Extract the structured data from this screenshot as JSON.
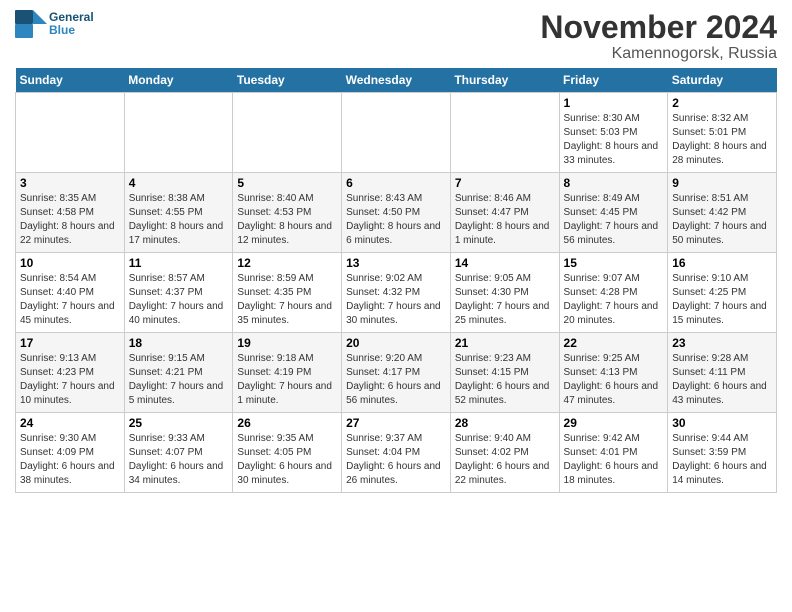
{
  "header": {
    "logo_line1": "General",
    "logo_line2": "Blue",
    "month_year": "November 2024",
    "location": "Kamennogorsk, Russia"
  },
  "weekdays": [
    "Sunday",
    "Monday",
    "Tuesday",
    "Wednesday",
    "Thursday",
    "Friday",
    "Saturday"
  ],
  "weeks": [
    [
      {
        "day": "",
        "info": ""
      },
      {
        "day": "",
        "info": ""
      },
      {
        "day": "",
        "info": ""
      },
      {
        "day": "",
        "info": ""
      },
      {
        "day": "",
        "info": ""
      },
      {
        "day": "1",
        "info": "Sunrise: 8:30 AM\nSunset: 5:03 PM\nDaylight: 8 hours and 33 minutes."
      },
      {
        "day": "2",
        "info": "Sunrise: 8:32 AM\nSunset: 5:01 PM\nDaylight: 8 hours and 28 minutes."
      }
    ],
    [
      {
        "day": "3",
        "info": "Sunrise: 8:35 AM\nSunset: 4:58 PM\nDaylight: 8 hours and 22 minutes."
      },
      {
        "day": "4",
        "info": "Sunrise: 8:38 AM\nSunset: 4:55 PM\nDaylight: 8 hours and 17 minutes."
      },
      {
        "day": "5",
        "info": "Sunrise: 8:40 AM\nSunset: 4:53 PM\nDaylight: 8 hours and 12 minutes."
      },
      {
        "day": "6",
        "info": "Sunrise: 8:43 AM\nSunset: 4:50 PM\nDaylight: 8 hours and 6 minutes."
      },
      {
        "day": "7",
        "info": "Sunrise: 8:46 AM\nSunset: 4:47 PM\nDaylight: 8 hours and 1 minute."
      },
      {
        "day": "8",
        "info": "Sunrise: 8:49 AM\nSunset: 4:45 PM\nDaylight: 7 hours and 56 minutes."
      },
      {
        "day": "9",
        "info": "Sunrise: 8:51 AM\nSunset: 4:42 PM\nDaylight: 7 hours and 50 minutes."
      }
    ],
    [
      {
        "day": "10",
        "info": "Sunrise: 8:54 AM\nSunset: 4:40 PM\nDaylight: 7 hours and 45 minutes."
      },
      {
        "day": "11",
        "info": "Sunrise: 8:57 AM\nSunset: 4:37 PM\nDaylight: 7 hours and 40 minutes."
      },
      {
        "day": "12",
        "info": "Sunrise: 8:59 AM\nSunset: 4:35 PM\nDaylight: 7 hours and 35 minutes."
      },
      {
        "day": "13",
        "info": "Sunrise: 9:02 AM\nSunset: 4:32 PM\nDaylight: 7 hours and 30 minutes."
      },
      {
        "day": "14",
        "info": "Sunrise: 9:05 AM\nSunset: 4:30 PM\nDaylight: 7 hours and 25 minutes."
      },
      {
        "day": "15",
        "info": "Sunrise: 9:07 AM\nSunset: 4:28 PM\nDaylight: 7 hours and 20 minutes."
      },
      {
        "day": "16",
        "info": "Sunrise: 9:10 AM\nSunset: 4:25 PM\nDaylight: 7 hours and 15 minutes."
      }
    ],
    [
      {
        "day": "17",
        "info": "Sunrise: 9:13 AM\nSunset: 4:23 PM\nDaylight: 7 hours and 10 minutes."
      },
      {
        "day": "18",
        "info": "Sunrise: 9:15 AM\nSunset: 4:21 PM\nDaylight: 7 hours and 5 minutes."
      },
      {
        "day": "19",
        "info": "Sunrise: 9:18 AM\nSunset: 4:19 PM\nDaylight: 7 hours and 1 minute."
      },
      {
        "day": "20",
        "info": "Sunrise: 9:20 AM\nSunset: 4:17 PM\nDaylight: 6 hours and 56 minutes."
      },
      {
        "day": "21",
        "info": "Sunrise: 9:23 AM\nSunset: 4:15 PM\nDaylight: 6 hours and 52 minutes."
      },
      {
        "day": "22",
        "info": "Sunrise: 9:25 AM\nSunset: 4:13 PM\nDaylight: 6 hours and 47 minutes."
      },
      {
        "day": "23",
        "info": "Sunrise: 9:28 AM\nSunset: 4:11 PM\nDaylight: 6 hours and 43 minutes."
      }
    ],
    [
      {
        "day": "24",
        "info": "Sunrise: 9:30 AM\nSunset: 4:09 PM\nDaylight: 6 hours and 38 minutes."
      },
      {
        "day": "25",
        "info": "Sunrise: 9:33 AM\nSunset: 4:07 PM\nDaylight: 6 hours and 34 minutes."
      },
      {
        "day": "26",
        "info": "Sunrise: 9:35 AM\nSunset: 4:05 PM\nDaylight: 6 hours and 30 minutes."
      },
      {
        "day": "27",
        "info": "Sunrise: 9:37 AM\nSunset: 4:04 PM\nDaylight: 6 hours and 26 minutes."
      },
      {
        "day": "28",
        "info": "Sunrise: 9:40 AM\nSunset: 4:02 PM\nDaylight: 6 hours and 22 minutes."
      },
      {
        "day": "29",
        "info": "Sunrise: 9:42 AM\nSunset: 4:01 PM\nDaylight: 6 hours and 18 minutes."
      },
      {
        "day": "30",
        "info": "Sunrise: 9:44 AM\nSunset: 3:59 PM\nDaylight: 6 hours and 14 minutes."
      }
    ]
  ]
}
